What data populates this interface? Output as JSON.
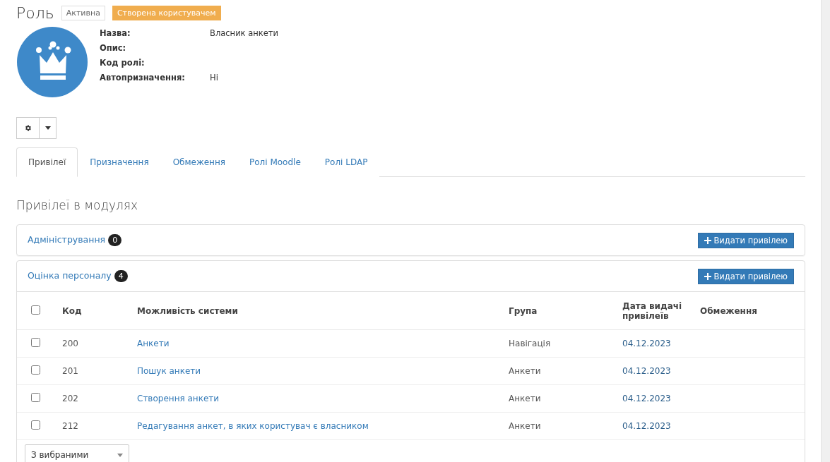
{
  "header": {
    "title": "Роль",
    "badges": [
      {
        "label": "Активна",
        "kind": "outline"
      },
      {
        "label": "Створена користувачем",
        "kind": "warning"
      }
    ]
  },
  "details": [
    {
      "label": "Назва:",
      "value": "Власник анкети"
    },
    {
      "label": "Опис:"
    },
    {
      "label": "Код ролі:"
    },
    {
      "label": "Автопризначення:",
      "value": "Ні"
    }
  ],
  "tabs": [
    {
      "label": "Привілеї",
      "selected": true
    },
    {
      "label": "Призначення",
      "selected": false
    },
    {
      "label": "Обмеження",
      "selected": false
    },
    {
      "label": "Ролі Moodle",
      "selected": false
    },
    {
      "label": "Ролі LDAP",
      "selected": false
    }
  ],
  "section_title": "Привілеї в модулях",
  "modules": [
    {
      "name": "Адміністрування",
      "count": "0",
      "button": "Видати привілею",
      "expanded": false
    },
    {
      "name": "Оцінка персоналу",
      "count": "4",
      "button": "Видати привілею",
      "expanded": true,
      "table": {
        "columns": [
          "Код",
          "Можливість системи",
          "Група",
          "Дата видачі привілеїв",
          "Обмеження"
        ],
        "header_checked": false,
        "rows": [
          {
            "checked": false,
            "code": "200",
            "capability": "Анкети",
            "group": "Навігація",
            "date": "04.12.2023"
          },
          {
            "checked": false,
            "code": "201",
            "capability": "Пошук анкети",
            "group": "Анкети",
            "date": "04.12.2023"
          },
          {
            "checked": false,
            "code": "202",
            "capability": "Створення анкети",
            "group": "Анкети",
            "date": "04.12.2023"
          },
          {
            "checked": false,
            "code": "212",
            "capability": "Редагування анкет, в яких користувач є власником",
            "group": "Анкети",
            "date": "04.12.2023"
          }
        ]
      },
      "bulk_select": "З вибраними"
    }
  ]
}
